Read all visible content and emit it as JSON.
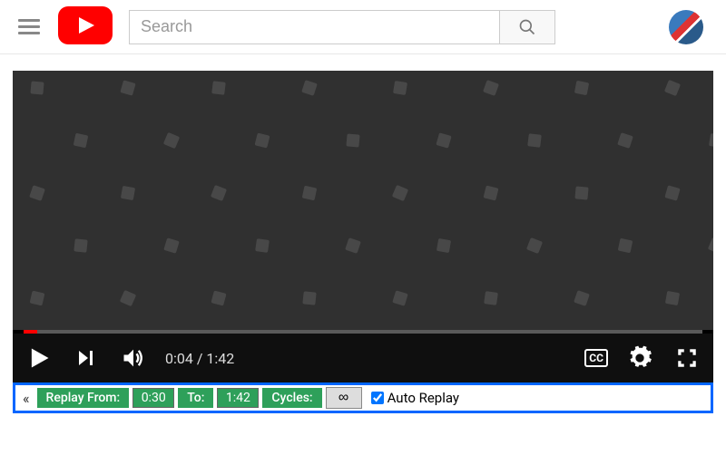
{
  "header": {
    "search_placeholder": "Search"
  },
  "player": {
    "current_time": "0:04",
    "duration": "1:42",
    "time_separator": " / ",
    "progress_percent": 2,
    "cc_label": "CC"
  },
  "replay": {
    "collapse_glyph": "«",
    "from_label": "Replay From:",
    "from_value": "0:30",
    "to_label": "To:",
    "to_value": "1:42",
    "cycles_label": "Cycles:",
    "cycles_value": "∞",
    "auto_replay_label": "Auto Replay",
    "auto_replay_checked": true
  },
  "colors": {
    "accent_red": "#ff0000",
    "replay_border": "#0066ff",
    "replay_green": "#2ea05a"
  }
}
